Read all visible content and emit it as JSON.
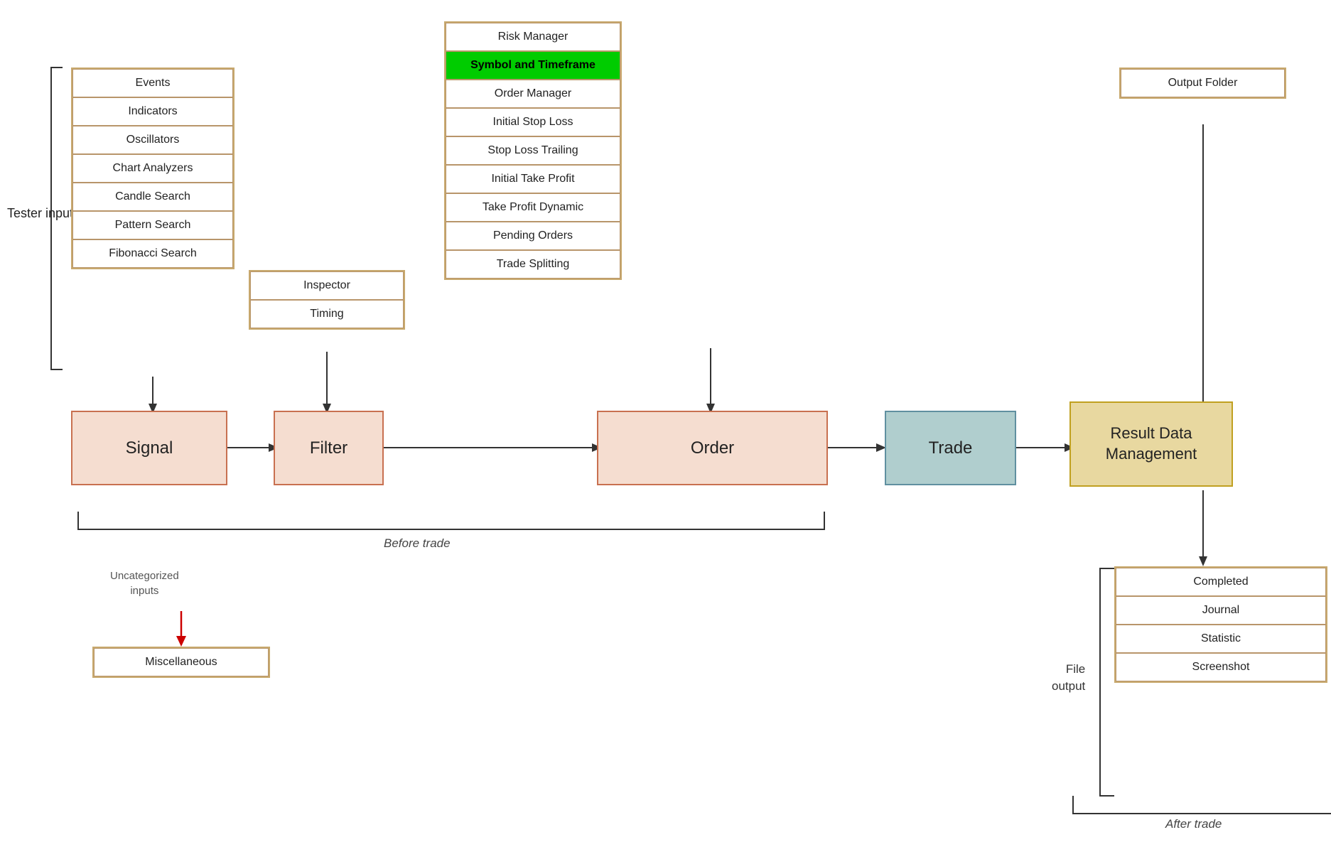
{
  "testerInput": {
    "label": "Tester input"
  },
  "inputGroup": {
    "items": [
      {
        "label": "Events"
      },
      {
        "label": "Indicators"
      },
      {
        "label": "Oscillators"
      },
      {
        "label": "Chart Analyzers"
      },
      {
        "label": "Candle Search"
      },
      {
        "label": "Pattern Search"
      },
      {
        "label": "Fibonacci Search"
      }
    ]
  },
  "filterGroup": {
    "items": [
      {
        "label": "Inspector"
      },
      {
        "label": "Timing"
      }
    ]
  },
  "orderGroup": {
    "items": [
      {
        "label": "Risk Manager"
      },
      {
        "label": "Symbol and Timeframe",
        "highlight": true
      },
      {
        "label": "Order Manager"
      },
      {
        "label": "Initial Stop Loss"
      },
      {
        "label": "Stop Loss Trailing"
      },
      {
        "label": "Initial Take Profit"
      },
      {
        "label": "Take Profit Dynamic"
      },
      {
        "label": "Pending Orders"
      },
      {
        "label": "Trade Splitting"
      }
    ]
  },
  "outputGroup": {
    "items": [
      {
        "label": "Output Folder"
      }
    ]
  },
  "fileOutputGroup": {
    "items": [
      {
        "label": "Completed"
      },
      {
        "label": "Journal"
      },
      {
        "label": "Statistic"
      },
      {
        "label": "Screenshot"
      }
    ]
  },
  "processBoxes": {
    "signal": "Signal",
    "filter": "Filter",
    "order": "Order",
    "trade": "Trade",
    "result": "Result Data\nManagement"
  },
  "labels": {
    "beforeTrade": "Before trade",
    "afterTrade": "After trade",
    "fileOutput": "File\noutput",
    "uncategorized": "Uncategorized\ninputs",
    "miscellaneous": "Miscellaneous"
  }
}
